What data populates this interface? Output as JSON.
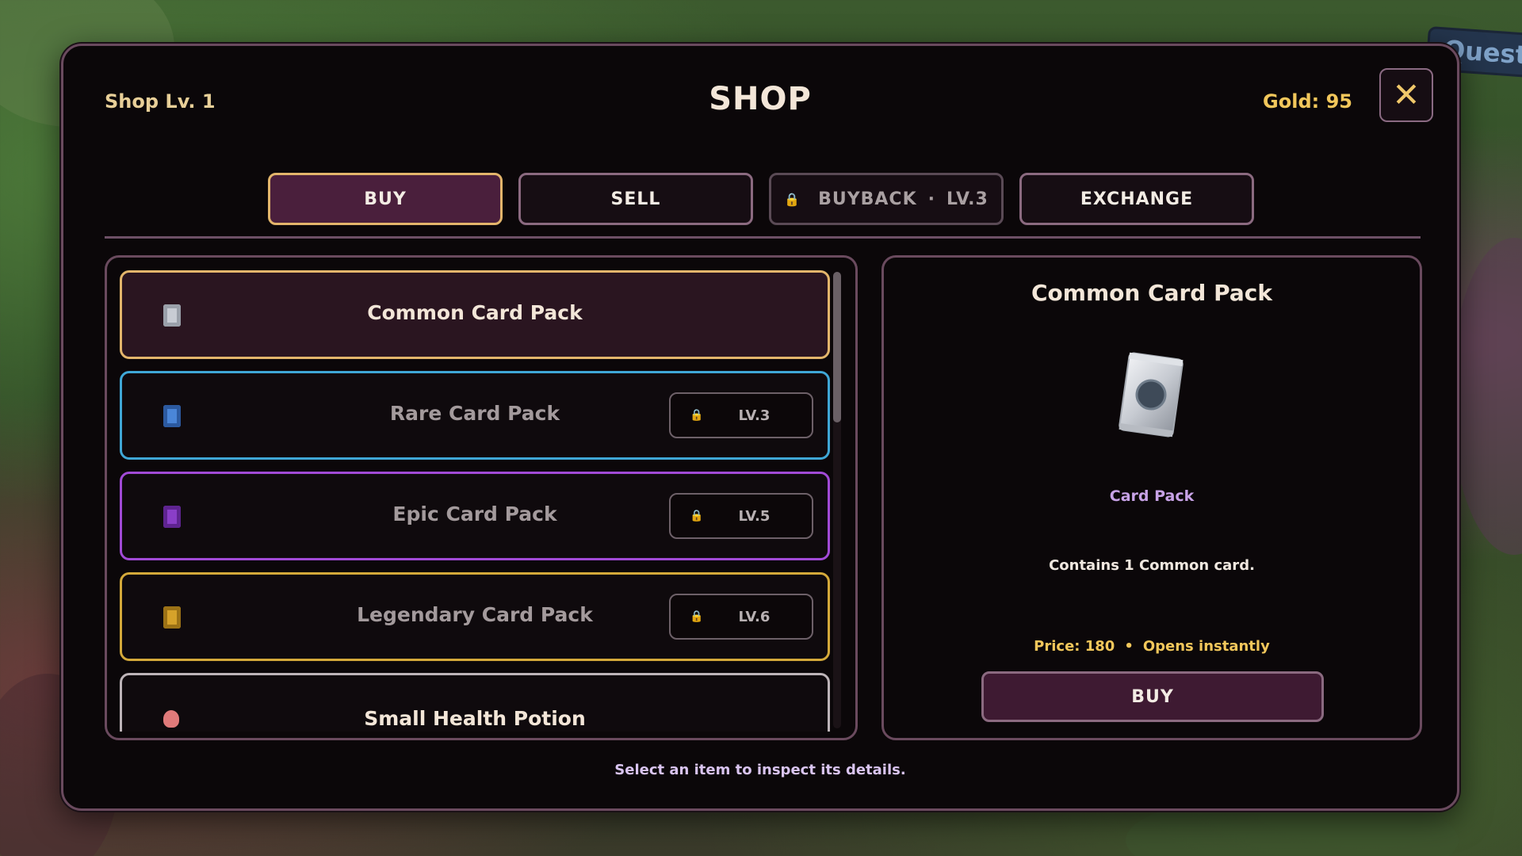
{
  "background": {
    "quest_label": "Quest"
  },
  "header": {
    "shop_level": "Shop Lv. 1",
    "title": "SHOP",
    "gold": "Gold:  95",
    "close_icon": "close-icon"
  },
  "tabs": [
    {
      "label": "BUY",
      "active": true,
      "locked": false
    },
    {
      "label": "SELL",
      "active": false,
      "locked": false
    },
    {
      "label": "BUYBACK",
      "level": "LV.3",
      "separator": "·",
      "active": false,
      "locked": true
    },
    {
      "label": "EXCHANGE",
      "active": false,
      "locked": false
    }
  ],
  "items": [
    {
      "name": "Common Card Pack",
      "icon": "common-card-pack-icon",
      "border": "#e3b56b",
      "icon_color": "#c8ccd4",
      "selected": true,
      "locked": false
    },
    {
      "name": "Rare Card Pack",
      "icon": "rare-card-pack-icon",
      "border": "#3fa7d6",
      "icon_color": "#4a86d8",
      "selected": false,
      "locked": true,
      "lock_level": "LV.3"
    },
    {
      "name": "Epic Card Pack",
      "icon": "epic-card-pack-icon",
      "border": "#a14ad6",
      "icon_color": "#8a3ec8",
      "selected": false,
      "locked": true,
      "lock_level": "LV.5"
    },
    {
      "name": "Legendary Card Pack",
      "icon": "legendary-card-pack-icon",
      "border": "#d4a93a",
      "icon_color": "#d6a22a",
      "selected": false,
      "locked": true,
      "lock_level": "LV.6"
    },
    {
      "name": "Small Health Potion",
      "icon": "health-potion-icon",
      "border": "#bdb4b8",
      "icon_color": "#e07a7a",
      "selected": false,
      "locked": false
    }
  ],
  "detail": {
    "title": "Common Card Pack",
    "art_icon": "common-card-pack-art",
    "category": "Card Pack",
    "description": "Contains 1 Common card.",
    "price": "Price: 180",
    "price_dot": "•",
    "opens": "Opens instantly",
    "buy_label": "BUY"
  },
  "footer_hint": "Select an item to inspect its details.",
  "colors": {
    "accent_gold": "#f2c75b",
    "panel_border": "#6a4a5e",
    "active_tab_bg": "#4a1f3c"
  }
}
